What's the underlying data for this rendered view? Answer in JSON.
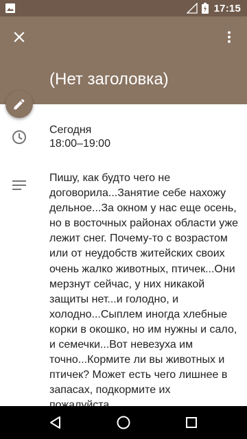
{
  "status_bar": {
    "time": "17:15",
    "icons": [
      "gallery-icon",
      "signal-icon",
      "battery-charging-icon"
    ]
  },
  "header": {
    "title": "(Нет заголовка)",
    "icons": [
      "close-icon",
      "more-vert-icon"
    ],
    "color": "#8a7462"
  },
  "fab": {
    "icon": "edit-icon"
  },
  "event": {
    "day": "Сегодня",
    "time_range": "18:00–19:00",
    "description": "Пишу, как будто чего не договорила...Занятие себе нахожу дельное...За окном у нас еще осень, но в восточных районах области уже лежит снег. Почему-то с возрастом или от неудобств житейских своих очень жалко животных, птичек...Они мерзнут сейчас, у них никакой защиты нет...и голодно, и холодно...Сыплем иногда хлебные корки в окошко, но им нужны и сало, и семечки...Вот невезуха им точно...Кормите ли вы животных и птичек? Может есть чего лишнее в запасах, подкормите их пожалуйста...."
  },
  "nav_bar": {
    "icons": [
      "back-icon",
      "home-icon",
      "recents-icon"
    ]
  }
}
